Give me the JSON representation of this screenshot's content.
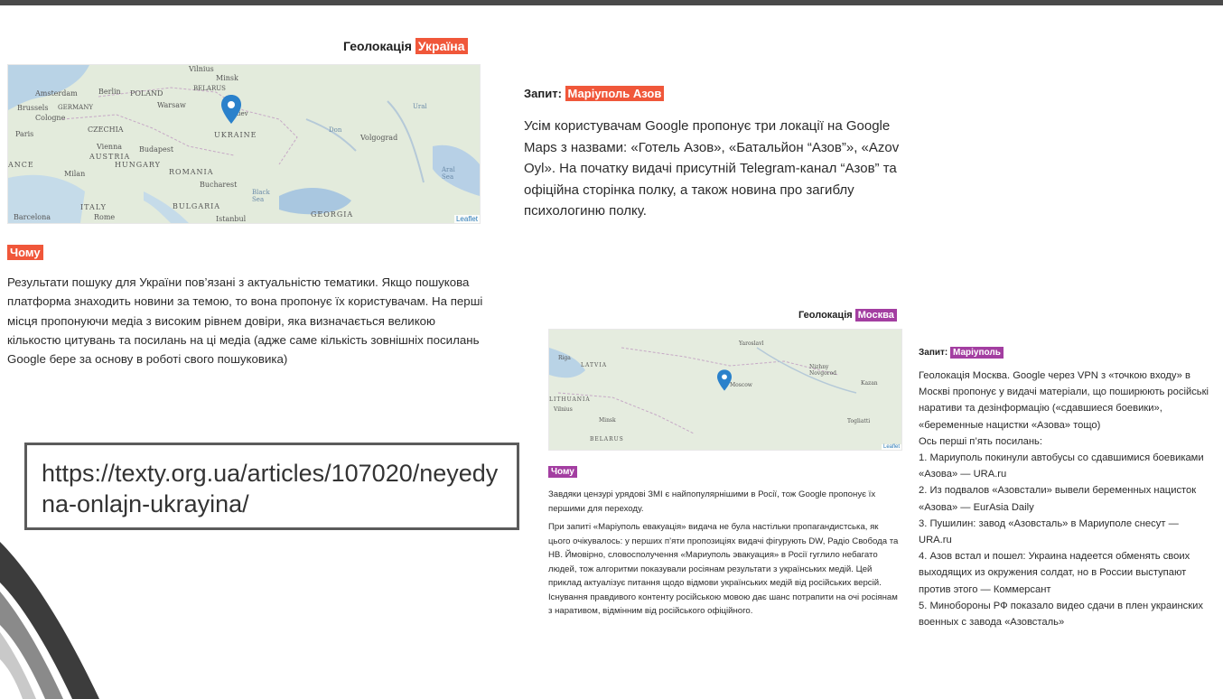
{
  "left": {
    "geo_label": "Геолокація",
    "geo_value": "Україна",
    "map_labels": [
      "Vilnius",
      "Minsk",
      "Amsterdam",
      "Berlin",
      "POLAND",
      "BELARUS",
      "Brussels",
      "GERMANY",
      "Warsaw",
      "Cologne",
      "Kiev",
      "Paris",
      "CZECHIA",
      "UKRAINE",
      "Volgograd",
      "Vienna",
      "Budapest",
      "AUSTRIA",
      "ANCE",
      "HUNGARY",
      "Milan",
      "ROMANIA",
      "Bucharest",
      "Black Sea",
      "ITALY",
      "BULGARIA",
      "Barcelona",
      "Rome",
      "Istanbul",
      "GEORGIA",
      "Aral Sea",
      "Don",
      "Ural"
    ],
    "leaflet": "Leaflet",
    "why_tag": "Чому",
    "why_text": "Результати пошуку для України пов’язані з актуальністю тематики. Якщо пошукова платформа знаходить новини за темою, то вона пропонує їх користувачам. На перші місця пропонуючи медіа з високим рівнем довіри, яка визначається великою кількостю цитувань та посилань на ці медіа (адже саме кількість зовнішніх посилань Google бере за основу в роботі свого пошуковика)"
  },
  "right_top": {
    "query_label": "Запит:",
    "query_value": "Маріуполь Азов",
    "text": "Усім користувачам Google пропонує три локації на Google Maps з назвами: «Готель Азов», «Батальйон “Азов”», «Azov Oyl». На початку видачі присутній Telegram-канал “Азов” та офіційна сторінка полку, а також новина про загиблу психологиню полку."
  },
  "url_box": "https://texty.org.ua/articles/107020/neyedyna-onlajn-ukrayina/",
  "moscow": {
    "geo_label": "Геолокація",
    "geo_value": "Москва",
    "map_labels": [
      "Riga",
      "LATVIA",
      "Yaroslavl",
      "Nizhny Novgorod",
      "Kazan",
      "LITHUANIA",
      "Vilnius",
      "Minsk",
      "Moscow",
      "Togliatti",
      "BELARUS"
    ],
    "leaflet": "Leaflet",
    "why_tag": "Чому",
    "why_p1": "Завдяки цензурі урядові ЗМІ є найпопулярнішими в Росії, тож Google пропонує їх першими для переходу.",
    "why_p2": "При запиті «Маріуполь евакуація» видача не була настільки пропагандистська, як цього очікувалось: у перших п’яти пропозиціях видачі фігурують DW, Радіо Свобода та НВ. Ймовірно, словосполучення «Мариуполь эвакуация» в Росії гуглило небагато людей, тож алгоритми показували росіянам результати з українських медій. Цей приклад актуалізує питання щодо відмови українських медій від російських версій. Існування правдивого контенту російською мовою дає шанс потрапити на очі росіянам з наративом, відмінним від російського офіційного.",
    "query_label": "Запит:",
    "query_value": "Маріуполь",
    "query_text": "Геолокація Москва. Google через VPN з «точкою входу» в Москві пропонує у видачі матеріали, що поширюють російські наративи та дезінформацію («сдавшиеся боевики», «беременные нацистки «Азова» тощо)",
    "links_intro": "Ось перші п’ять посилань:",
    "links": [
      "1. Мариуполь покинули автобусы со сдавшимися боевиками «Азова» — URA.ru",
      "2. Из подвалов «Азовстали» вывели беременных нацисток «Азова» — EurAsia Daily",
      "3. Пушилин: завод «Азовсталь» в Мариуполе снесут — URA.ru",
      "4. Азов встал и пошел: Украина надеется обменять своих выходящих из окружения солдат, но в России выступают против этого — Коммерсант",
      "5. Минобороны РФ показало видео сдачи в плен украинских военных с завода «Азовсталь»"
    ]
  }
}
